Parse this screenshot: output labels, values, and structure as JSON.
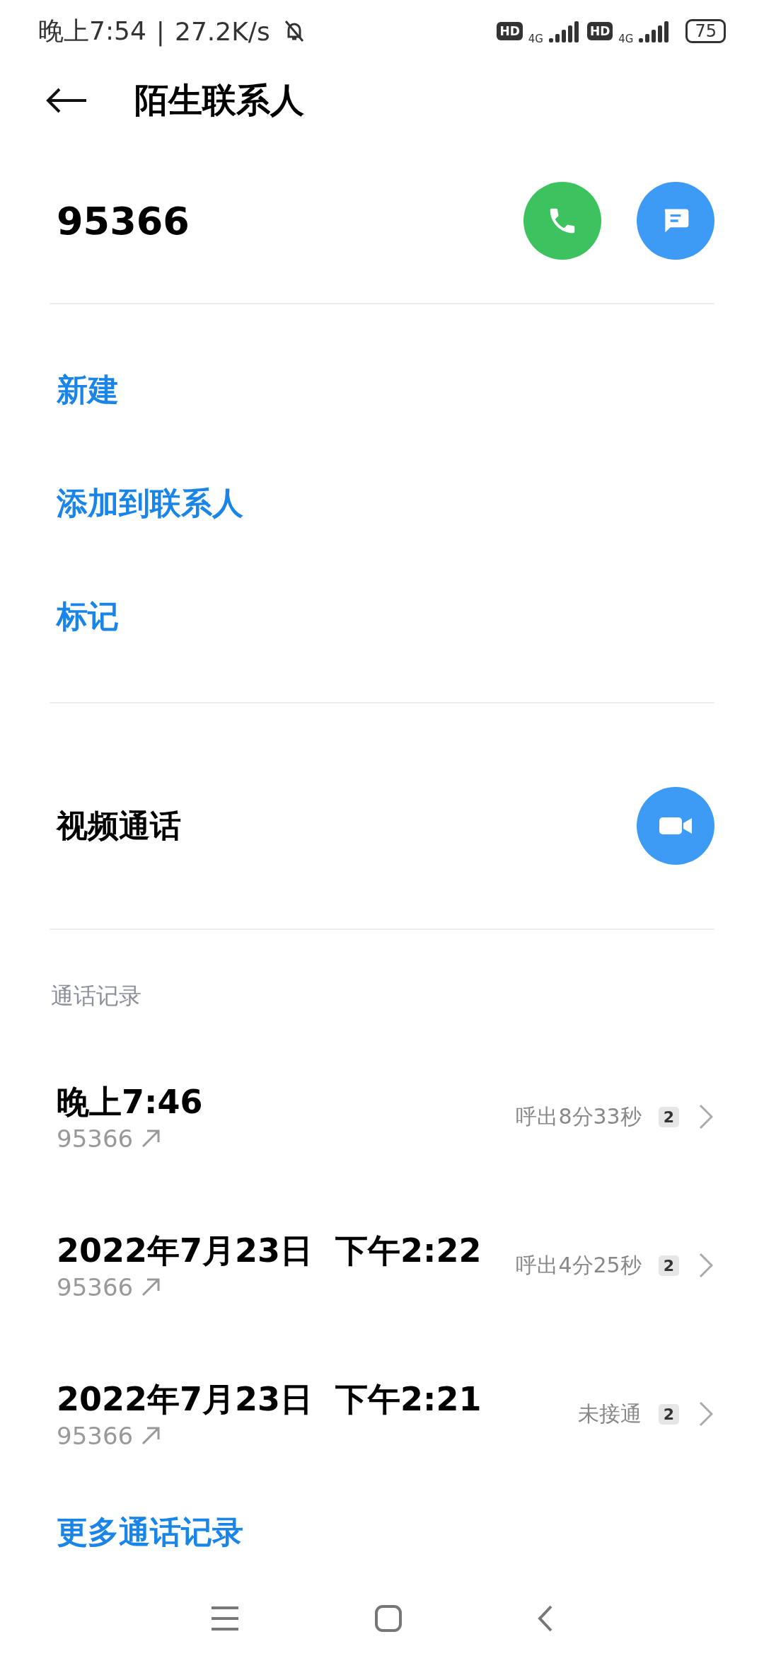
{
  "status_bar": {
    "time": "晚上7:54",
    "separator": "|",
    "speed": "27.2K/s",
    "sims": [
      {
        "hd": "HD",
        "network": "4G"
      },
      {
        "hd": "HD",
        "network": "4G"
      }
    ],
    "battery": "75"
  },
  "header": {
    "title": "陌生联系人"
  },
  "contact": {
    "number": "95366"
  },
  "actions": [
    {
      "label": "新建"
    },
    {
      "label": "添加到联系人"
    },
    {
      "label": "标记"
    }
  ],
  "video_call": {
    "label": "视频通话"
  },
  "call_log": {
    "title": "通话记录",
    "entries": [
      {
        "time": "晚上7:46",
        "number": "95366",
        "status": "呼出8分33秒",
        "sim": "2"
      },
      {
        "time": "2022年7月23日  下午2:22",
        "number": "95366",
        "status": "呼出4分25秒",
        "sim": "2"
      },
      {
        "time": "2022年7月23日  下午2:21",
        "number": "95366",
        "status": "未接通",
        "sim": "2"
      }
    ],
    "more": "更多通话记录"
  }
}
